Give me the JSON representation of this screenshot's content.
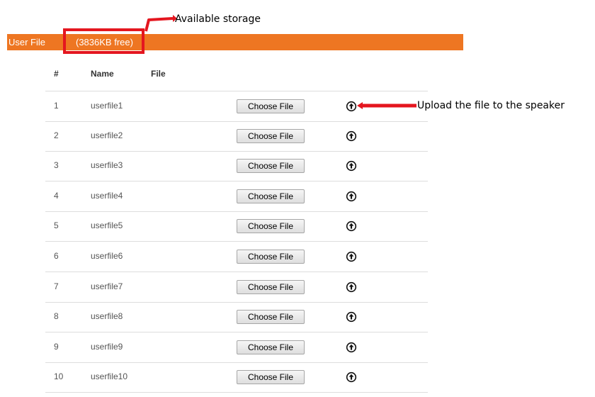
{
  "annotations": {
    "available_storage": "Available storage",
    "upload_note": "Upload the file to the speaker",
    "highlight_color": "#e4161f"
  },
  "header": {
    "title": "User File",
    "free_space": "(3836KB free)",
    "bar_color": "#ee7622"
  },
  "table": {
    "columns": [
      "#",
      "Name",
      "File"
    ],
    "button_label": "Choose File",
    "upload_icon": "upload-circle-icon",
    "rows": [
      {
        "num": "1",
        "name": "userfile1"
      },
      {
        "num": "2",
        "name": "userfile2"
      },
      {
        "num": "3",
        "name": "userfile3"
      },
      {
        "num": "4",
        "name": "userfile4"
      },
      {
        "num": "5",
        "name": "userfile5"
      },
      {
        "num": "6",
        "name": "userfile6"
      },
      {
        "num": "7",
        "name": "userfile7"
      },
      {
        "num": "8",
        "name": "userfile8"
      },
      {
        "num": "9",
        "name": "userfile9"
      },
      {
        "num": "10",
        "name": "userfile10"
      }
    ]
  }
}
